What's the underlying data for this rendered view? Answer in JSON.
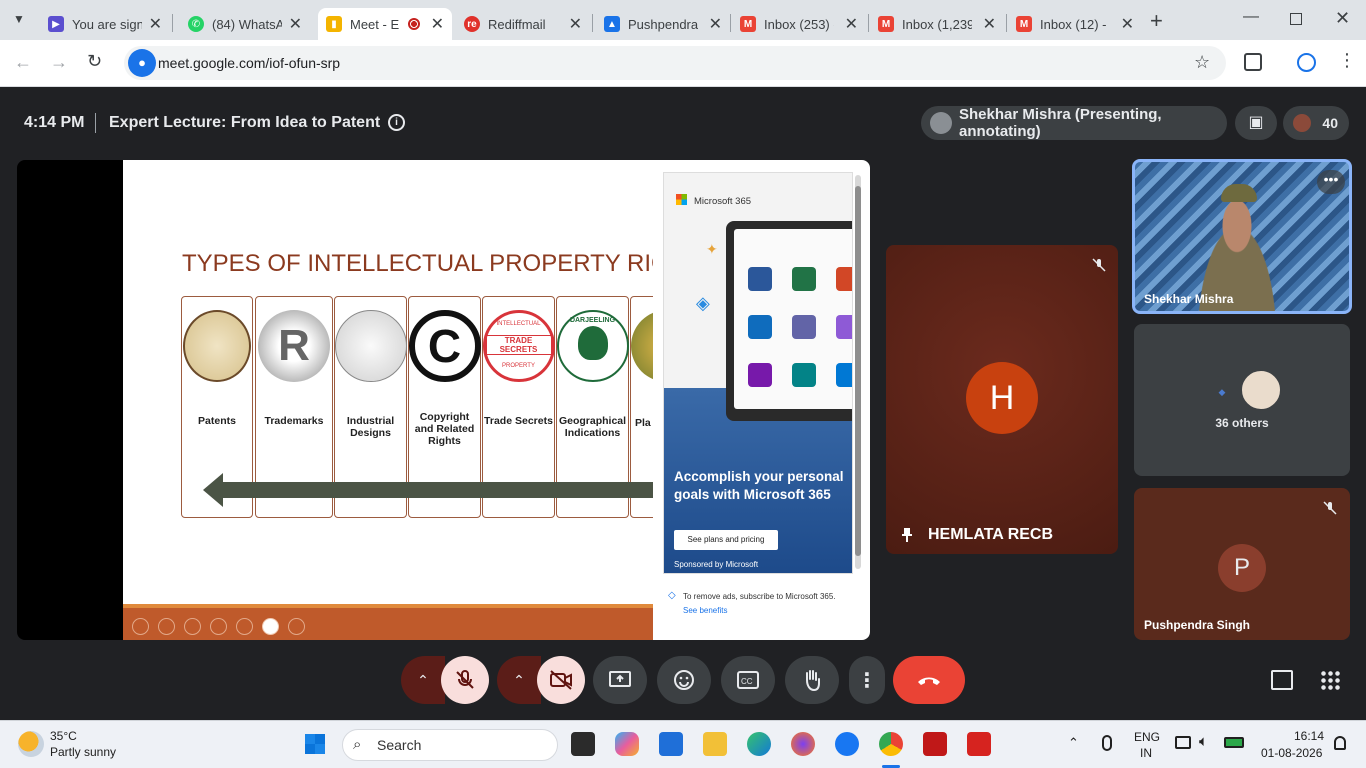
{
  "browser": {
    "tabs": [
      {
        "title": "You are signe",
        "icon": "stream-icon",
        "color": "#5b4fcf"
      },
      {
        "title": "(84) WhatsAp",
        "icon": "whatsapp-icon",
        "color": "#25d366"
      },
      {
        "title": "Meet - E",
        "icon": "meet-icon",
        "color": "#f4b400",
        "active": true
      },
      {
        "title": "Rediffmail",
        "icon": "rediff-icon",
        "color": "#e0312b"
      },
      {
        "title": "Pushpendra",
        "icon": "classroom-icon",
        "color": "#1a73e8"
      },
      {
        "title": "Inbox (253) -",
        "icon": "gmail-icon",
        "color": "#ea4335"
      },
      {
        "title": "Inbox (1,239",
        "icon": "gmail-icon",
        "color": "#ea4335"
      },
      {
        "title": "Inbox (12) - ",
        "icon": "gmail-icon",
        "color": "#ea4335"
      }
    ],
    "url": "meet.google.com/iof-ofun-srp"
  },
  "meet": {
    "time": "4:14 PM",
    "title": "Expert Lecture: From Idea to Patent",
    "presenter": "Shekhar Mishra (Presenting, annotating)",
    "participant_count": "40",
    "slide": {
      "title": "TYPES OF INTELLECTUAL PROPERTY RIGHT",
      "cards": [
        "Patents",
        "Trademarks",
        "Industrial Designs",
        "Copyright and Related Rights",
        "Trade Secrets",
        "Geographical Indications",
        "Pla"
      ],
      "seal_text": "TRADE SECRETS",
      "seal_top": "INTELLECTUAL",
      "seal_bottom": "PROPERTY",
      "darjeeling": "DARJEELING"
    },
    "ad": {
      "brand": "Microsoft 365",
      "headline": "Accomplish your personal goals with Microsoft 365",
      "button": "See plans and pricing",
      "sponsor": "Sponsored by Microsoft",
      "remove": "To remove ads, subscribe to Microsoft 365.",
      "benefits": "See benefits"
    },
    "tiles": {
      "pinned_name": "HEMLATA RECB",
      "pinned_initial": "H",
      "speaker_name": "Shekhar Mishra",
      "others": "36 others",
      "p_name": "Pushpendra Singh",
      "p_initial": "P"
    },
    "colors": {
      "accent": "#8ab4f8",
      "end_call": "#ea4335",
      "muted": "#f9dedc"
    }
  },
  "taskbar": {
    "weather_temp": "35°C",
    "weather_desc": "Partly sunny",
    "search": "Search",
    "lang": "ENG",
    "region": "IN",
    "clock_time": "16:14",
    "clock_date": "01-08-2026"
  }
}
